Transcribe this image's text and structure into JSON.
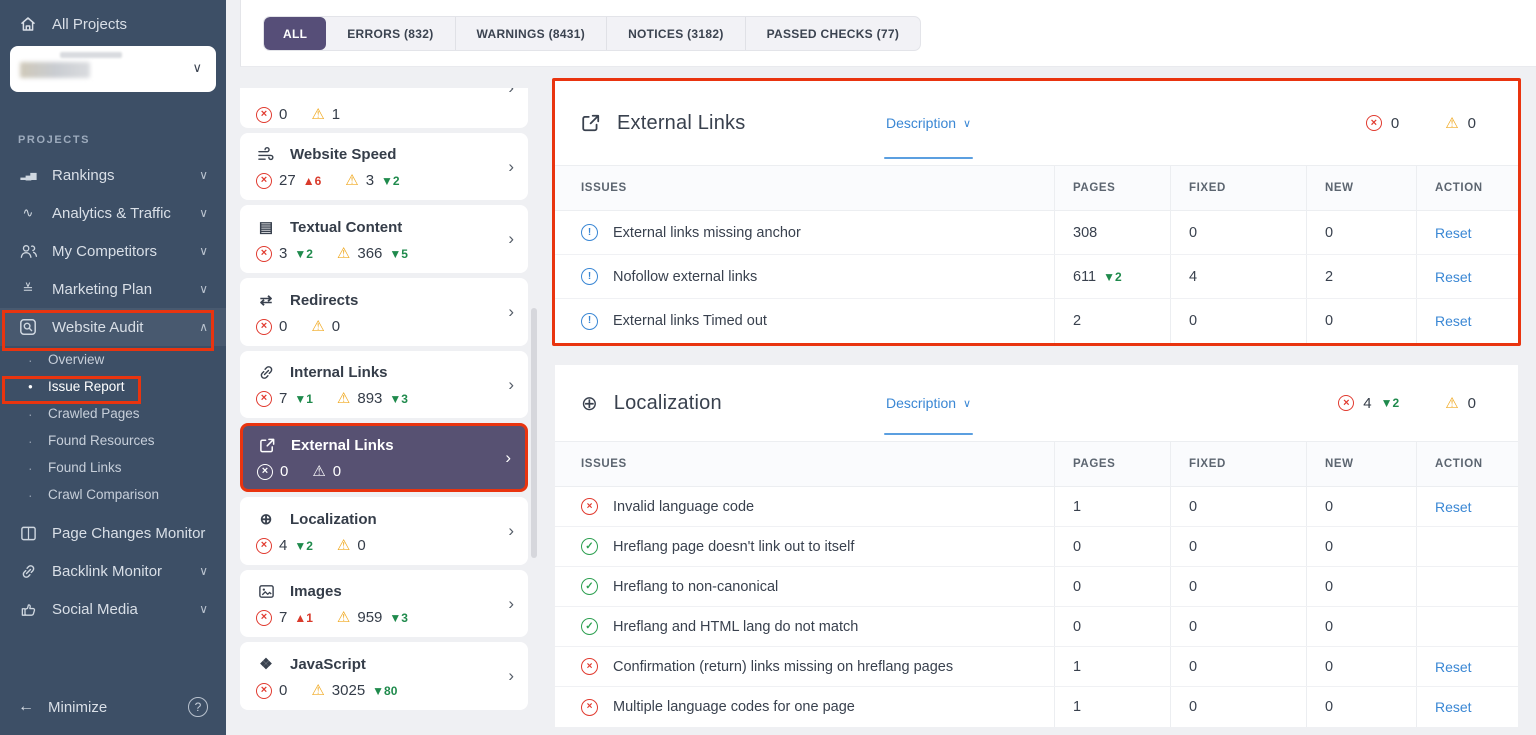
{
  "colors": {
    "sidebar_bg": "#3d4f66",
    "sidebar_selected_bg": "#48596f",
    "accent_purple": "#564e78",
    "annotation_red": "#e9340f",
    "error_red": "#e13b30",
    "warning_amber": "#f0a81f",
    "success_green": "#2da051",
    "trend_green": "#1f8a4c",
    "trend_red": "#d93a2b",
    "link_blue": "#3a87d4",
    "page_bg": "#eff0f3",
    "panel_bg": "#ffffff",
    "text_dark": "#39414e"
  },
  "icons": {
    "chevron-down": "∨",
    "chevron-up": "∧",
    "chevron-right": "›",
    "back-arrow": "←",
    "question": "?",
    "bar-chart": "▂▄▆",
    "pulse": "∿",
    "checklist": "≚",
    "document": "▤",
    "redirect": "⇄",
    "globe": "⊕",
    "cube": "❖",
    "error-x": "×",
    "check": "✓",
    "notice": "!",
    "warning": "⚠",
    "dot": "·",
    "active-dot": "●"
  },
  "sidebar": {
    "all_projects_label": "All Projects",
    "section_label": "PROJECTS",
    "items": [
      {
        "label": "Rankings",
        "icon": "bar-chart-icon",
        "chevron": "down"
      },
      {
        "label": "Analytics & Traffic",
        "icon": "pulse-icon",
        "chevron": "down"
      },
      {
        "label": "My Competitors",
        "icon": "people-icon",
        "chevron": "down"
      },
      {
        "label": "Marketing Plan",
        "icon": "checklist-icon",
        "chevron": "down"
      },
      {
        "label": "Website Audit",
        "icon": "audit-magnifier-icon",
        "chevron": "up",
        "selected": true
      }
    ],
    "audit_subitems": [
      {
        "label": "Overview"
      },
      {
        "label": "Issue Report",
        "active": true
      },
      {
        "label": "Crawled Pages"
      },
      {
        "label": "Found Resources"
      },
      {
        "label": "Found Links"
      },
      {
        "label": "Crawl Comparison"
      }
    ],
    "items_bottom": [
      {
        "label": "Page Changes Monitor",
        "icon": "pages-monitor-icon"
      },
      {
        "label": "Backlink Monitor",
        "icon": "link-icon",
        "chevron": "down"
      },
      {
        "label": "Social Media",
        "icon": "thumb-icon",
        "chevron": "down"
      }
    ],
    "footer": {
      "minimize_label": "Minimize",
      "help_icon": "question-icon"
    }
  },
  "tabs": [
    {
      "label": "ALL",
      "active": true
    },
    {
      "label": "ERRORS (832)"
    },
    {
      "label": "WARNINGS (8431)"
    },
    {
      "label": "NOTICES (3182)"
    },
    {
      "label": "PASSED CHECKS (77)"
    }
  ],
  "cards": [
    {
      "errors": "0",
      "warnings": "1"
    },
    {
      "label": "Website Speed",
      "icon": "wind-icon",
      "errors": "27",
      "errors_trend": "▲6",
      "warnings": "3",
      "warnings_trend": "▼2"
    },
    {
      "label": "Textual Content",
      "icon": "document-icon",
      "errors": "3",
      "errors_trend": "▼2",
      "warnings": "366",
      "warnings_trend": "▼5"
    },
    {
      "label": "Redirects",
      "icon": "redirect-icon",
      "errors": "0",
      "warnings": "0"
    },
    {
      "label": "Internal Links",
      "icon": "link-icon",
      "errors": "7",
      "errors_trend": "▼1",
      "warnings": "893",
      "warnings_trend": "▼3"
    },
    {
      "label": "External Links",
      "icon": "external-link-icon",
      "errors": "0",
      "warnings": "0",
      "selected": true
    },
    {
      "label": "Localization",
      "icon": "globe-icon",
      "errors": "4",
      "errors_trend": "▼2",
      "warnings": "0"
    },
    {
      "label": "Images",
      "icon": "image-icon",
      "errors": "7",
      "errors_trend": "▲1",
      "warnings": "959",
      "warnings_trend": "▼3"
    },
    {
      "label": "JavaScript",
      "icon": "cube-icon",
      "errors": "0",
      "warnings": "3025",
      "warnings_trend": "▼80"
    }
  ],
  "panels": {
    "external": {
      "title": "External Links",
      "icon": "external-link-icon",
      "description_label": "Description",
      "errors": "0",
      "warnings": "0",
      "columns": [
        "ISSUES",
        "PAGES",
        "FIXED",
        "NEW",
        "ACTION"
      ],
      "rows": [
        {
          "status": "notice",
          "issue": "External links missing anchor",
          "pages": "308",
          "fixed": "0",
          "new": "0",
          "action": "Reset"
        },
        {
          "status": "notice",
          "issue": "Nofollow external links",
          "pages": "611",
          "pages_trend": "▼2",
          "fixed": "4",
          "new": "2",
          "action": "Reset"
        },
        {
          "status": "notice",
          "issue": "External links Timed out",
          "pages": "2",
          "fixed": "0",
          "new": "0",
          "action": "Reset"
        }
      ]
    },
    "localization": {
      "title": "Localization",
      "icon": "globe-icon",
      "description_label": "Description",
      "errors": "4",
      "errors_trend": "▼2",
      "warnings": "0",
      "columns": [
        "ISSUES",
        "PAGES",
        "FIXED",
        "NEW",
        "ACTION"
      ],
      "rows": [
        {
          "status": "error",
          "issue": "Invalid language code",
          "pages": "1",
          "fixed": "0",
          "new": "0",
          "action": "Reset"
        },
        {
          "status": "ok",
          "issue": "Hreflang page doesn't link out to itself",
          "pages": "0",
          "fixed": "0",
          "new": "0",
          "action": ""
        },
        {
          "status": "ok",
          "issue": "Hreflang to non-canonical",
          "pages": "0",
          "fixed": "0",
          "new": "0",
          "action": ""
        },
        {
          "status": "ok",
          "issue": "Hreflang and HTML lang do not match",
          "pages": "0",
          "fixed": "0",
          "new": "0",
          "action": ""
        },
        {
          "status": "error",
          "issue": "Confirmation (return) links missing on hreflang pages",
          "pages": "1",
          "fixed": "0",
          "new": "0",
          "action": "Reset"
        },
        {
          "status": "error",
          "issue": "Multiple language codes for one page",
          "pages": "1",
          "fixed": "0",
          "new": "0",
          "action": "Reset"
        }
      ]
    }
  }
}
